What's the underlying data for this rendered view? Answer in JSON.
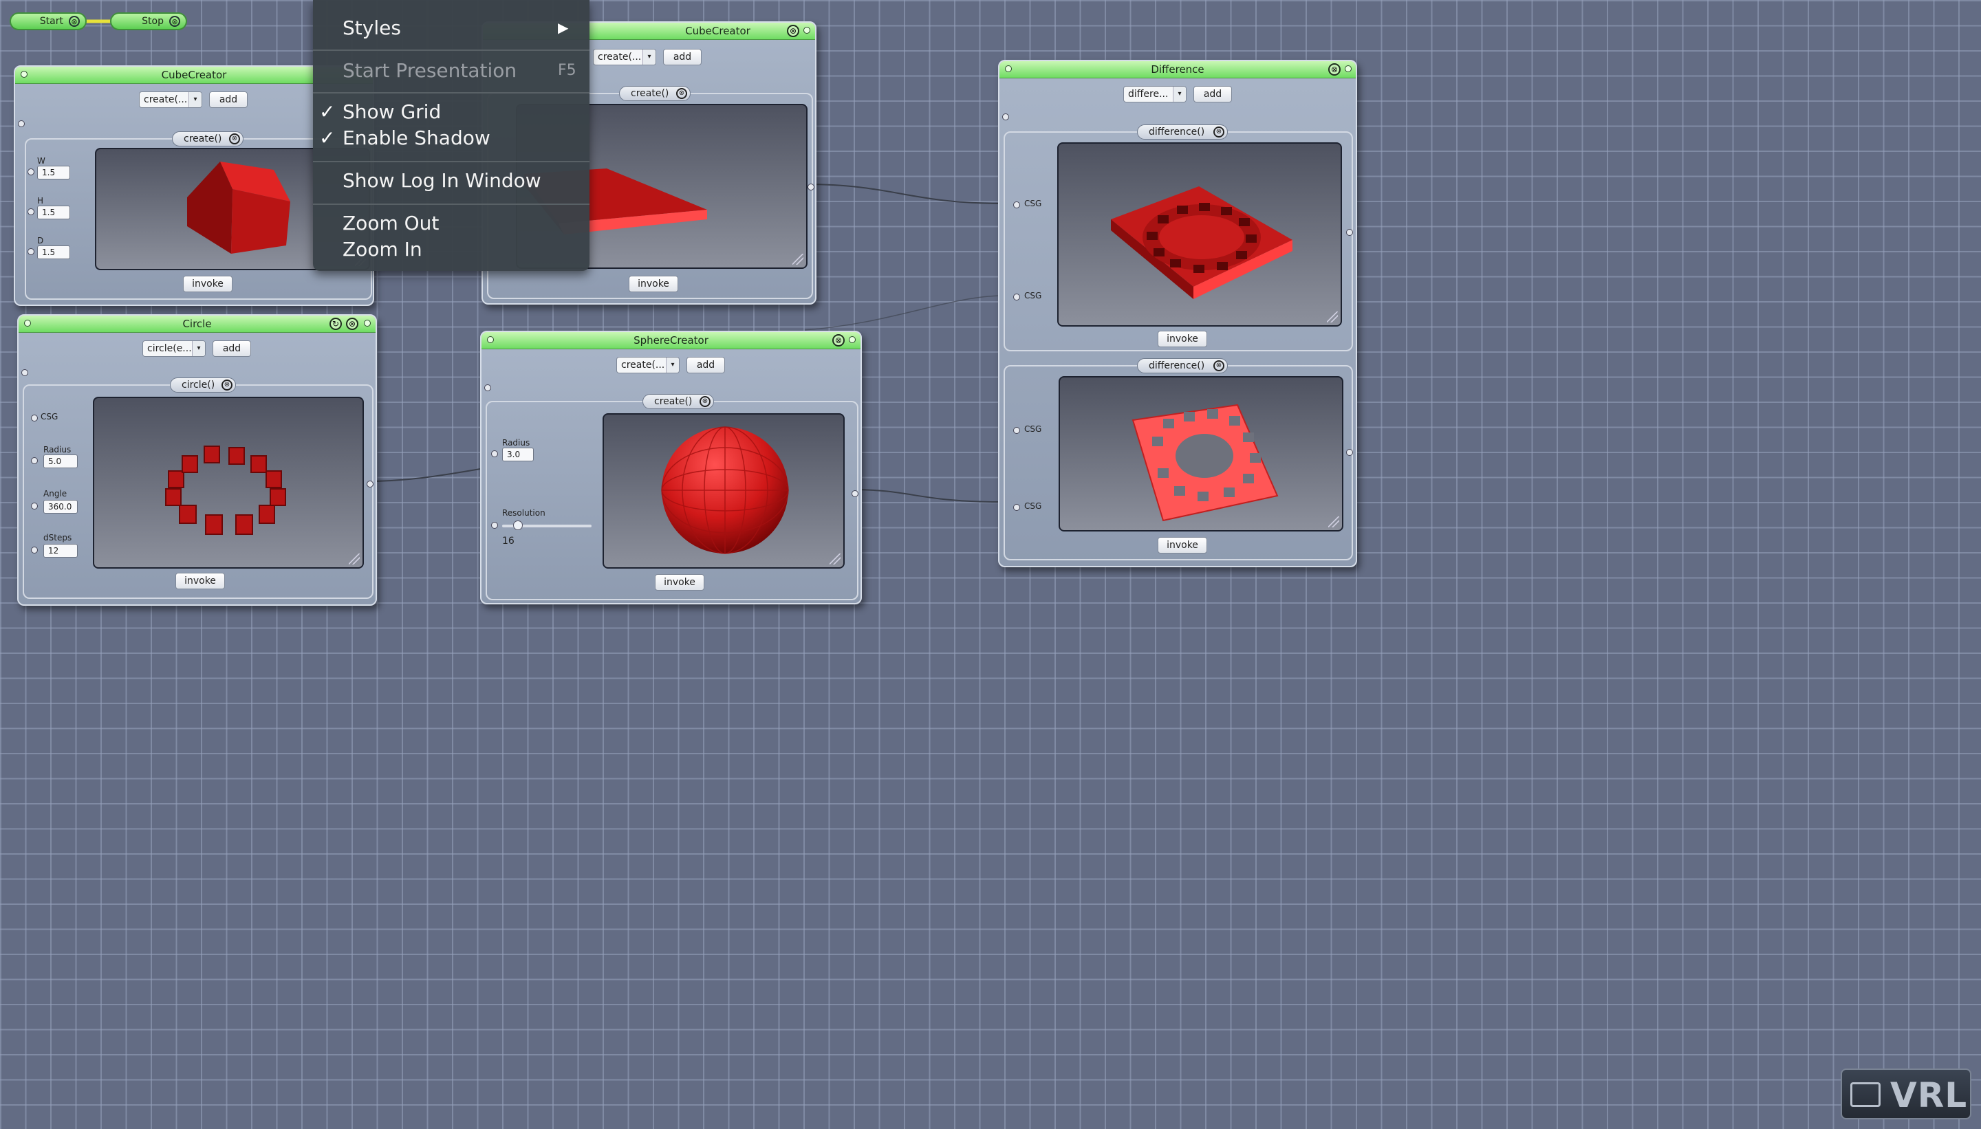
{
  "controls": {
    "start": "Start",
    "stop": "Stop"
  },
  "menu": {
    "items": [
      {
        "label": "Styles",
        "submenu": true
      },
      {
        "label": "Start Presentation",
        "shortcut": "F5",
        "disabled": true
      },
      {
        "label": "Show Grid",
        "checked": true
      },
      {
        "label": "Enable Shadow",
        "checked": true
      },
      {
        "label": "Show Log In Window"
      },
      {
        "label": "Zoom Out"
      },
      {
        "label": "Zoom In"
      }
    ],
    "check_mark": "✓",
    "submenu_arrow": "▶"
  },
  "common": {
    "add": "add",
    "invoke": "invoke",
    "close": "⊗",
    "combo_arrow": "▾",
    "csg": "CSG"
  },
  "cube1": {
    "title": "CubeCreator",
    "method": "create(...",
    "panel": "create()",
    "fields": [
      {
        "label": "W",
        "value": "1.5"
      },
      {
        "label": "H",
        "value": "1.5"
      },
      {
        "label": "D",
        "value": "1.5"
      }
    ]
  },
  "cube2": {
    "title": "CubeCreator",
    "method": "create(...",
    "panel": "create()"
  },
  "circle": {
    "title": "Circle",
    "method": "circle(e...",
    "panel": "circle()",
    "fields": [
      {
        "label": "Radius",
        "value": "5.0"
      },
      {
        "label": "Angle",
        "value": "360.0"
      },
      {
        "label": "dSteps",
        "value": "12"
      }
    ]
  },
  "sphere": {
    "title": "SphereCreator",
    "method": "create(...",
    "panel": "create()",
    "radius_label": "Radius",
    "radius_value": "3.0",
    "resolution_label": "Resolution",
    "resolution_value": "16"
  },
  "difference": {
    "title": "Difference",
    "method": "differe...",
    "panel": "difference()"
  },
  "logo": {
    "text": "VRL"
  },
  "colors": {
    "titlebar": "#6fdc62",
    "shape": "#c41a1a",
    "canvas": "#636c84"
  }
}
